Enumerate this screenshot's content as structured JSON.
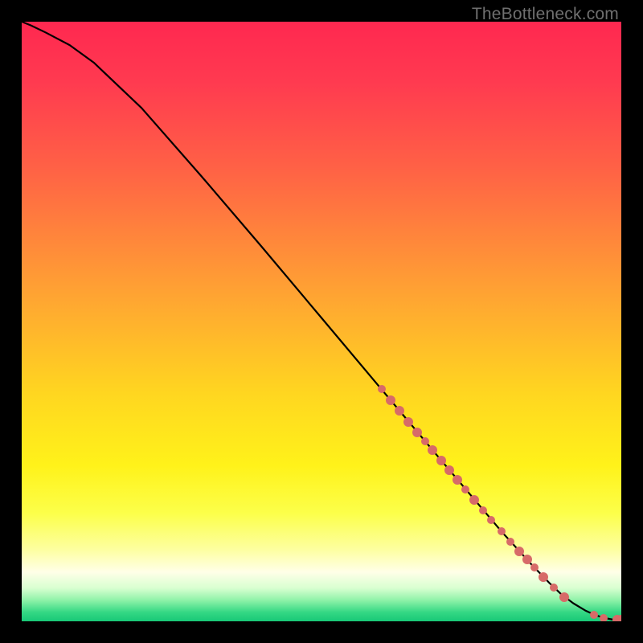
{
  "watermark": "TheBottleneck.com",
  "gradient_stops": [
    {
      "offset": 0.0,
      "color": "#ff2850"
    },
    {
      "offset": 0.1,
      "color": "#ff3a50"
    },
    {
      "offset": 0.25,
      "color": "#ff6345"
    },
    {
      "offset": 0.45,
      "color": "#ffa233"
    },
    {
      "offset": 0.62,
      "color": "#ffd620"
    },
    {
      "offset": 0.74,
      "color": "#fff21a"
    },
    {
      "offset": 0.82,
      "color": "#fcff4a"
    },
    {
      "offset": 0.88,
      "color": "#fdffa0"
    },
    {
      "offset": 0.918,
      "color": "#ffffe8"
    },
    {
      "offset": 0.945,
      "color": "#d8ffd0"
    },
    {
      "offset": 0.965,
      "color": "#8ef2a8"
    },
    {
      "offset": 0.985,
      "color": "#34d884"
    },
    {
      "offset": 1.0,
      "color": "#18c877"
    }
  ],
  "point_color": "#d76a68",
  "chart_data": {
    "type": "line",
    "title": "",
    "xlabel": "",
    "ylabel": "",
    "xlim": [
      0,
      100
    ],
    "ylim": [
      0,
      100
    ],
    "series": [
      {
        "name": "curve",
        "x": [
          0,
          1.5,
          4,
          8,
          12,
          20,
          30,
          40,
          50,
          60,
          70,
          75,
          80,
          85,
          88,
          90,
          92,
          94,
          95.5,
          97,
          98.5,
          100
        ],
        "y": [
          100,
          99.4,
          98.2,
          96.1,
          93.2,
          85.6,
          74.2,
          62.5,
          50.6,
          38.7,
          26.8,
          20.9,
          15.0,
          9.5,
          6.4,
          4.5,
          3.0,
          1.8,
          1.1,
          0.6,
          0.3,
          0.25
        ]
      }
    ],
    "points": [
      {
        "x": 60.0,
        "y": 38.7,
        "r": 5
      },
      {
        "x": 61.5,
        "y": 36.9,
        "r": 6
      },
      {
        "x": 63.0,
        "y": 35.1,
        "r": 6
      },
      {
        "x": 64.5,
        "y": 33.3,
        "r": 6
      },
      {
        "x": 66.0,
        "y": 31.5,
        "r": 6
      },
      {
        "x": 67.3,
        "y": 30.0,
        "r": 5
      },
      {
        "x": 68.5,
        "y": 28.5,
        "r": 6
      },
      {
        "x": 70.0,
        "y": 26.8,
        "r": 6
      },
      {
        "x": 71.3,
        "y": 25.2,
        "r": 6
      },
      {
        "x": 72.7,
        "y": 23.6,
        "r": 6
      },
      {
        "x": 74.0,
        "y": 22.0,
        "r": 5
      },
      {
        "x": 75.5,
        "y": 20.3,
        "r": 6
      },
      {
        "x": 77.0,
        "y": 18.5,
        "r": 5
      },
      {
        "x": 78.3,
        "y": 16.9,
        "r": 5
      },
      {
        "x": 80.0,
        "y": 15.0,
        "r": 5
      },
      {
        "x": 81.5,
        "y": 13.3,
        "r": 5
      },
      {
        "x": 83.0,
        "y": 11.7,
        "r": 6
      },
      {
        "x": 84.3,
        "y": 10.3,
        "r": 6
      },
      {
        "x": 85.5,
        "y": 9.0,
        "r": 5
      },
      {
        "x": 87.0,
        "y": 7.4,
        "r": 6
      },
      {
        "x": 88.8,
        "y": 5.6,
        "r": 5
      },
      {
        "x": 90.5,
        "y": 4.0,
        "r": 6
      },
      {
        "x": 95.5,
        "y": 1.1,
        "r": 5
      },
      {
        "x": 97.0,
        "y": 0.6,
        "r": 5
      },
      {
        "x": 99.3,
        "y": 0.25,
        "r": 6
      },
      {
        "x": 100.0,
        "y": 0.25,
        "r": 6
      }
    ]
  }
}
